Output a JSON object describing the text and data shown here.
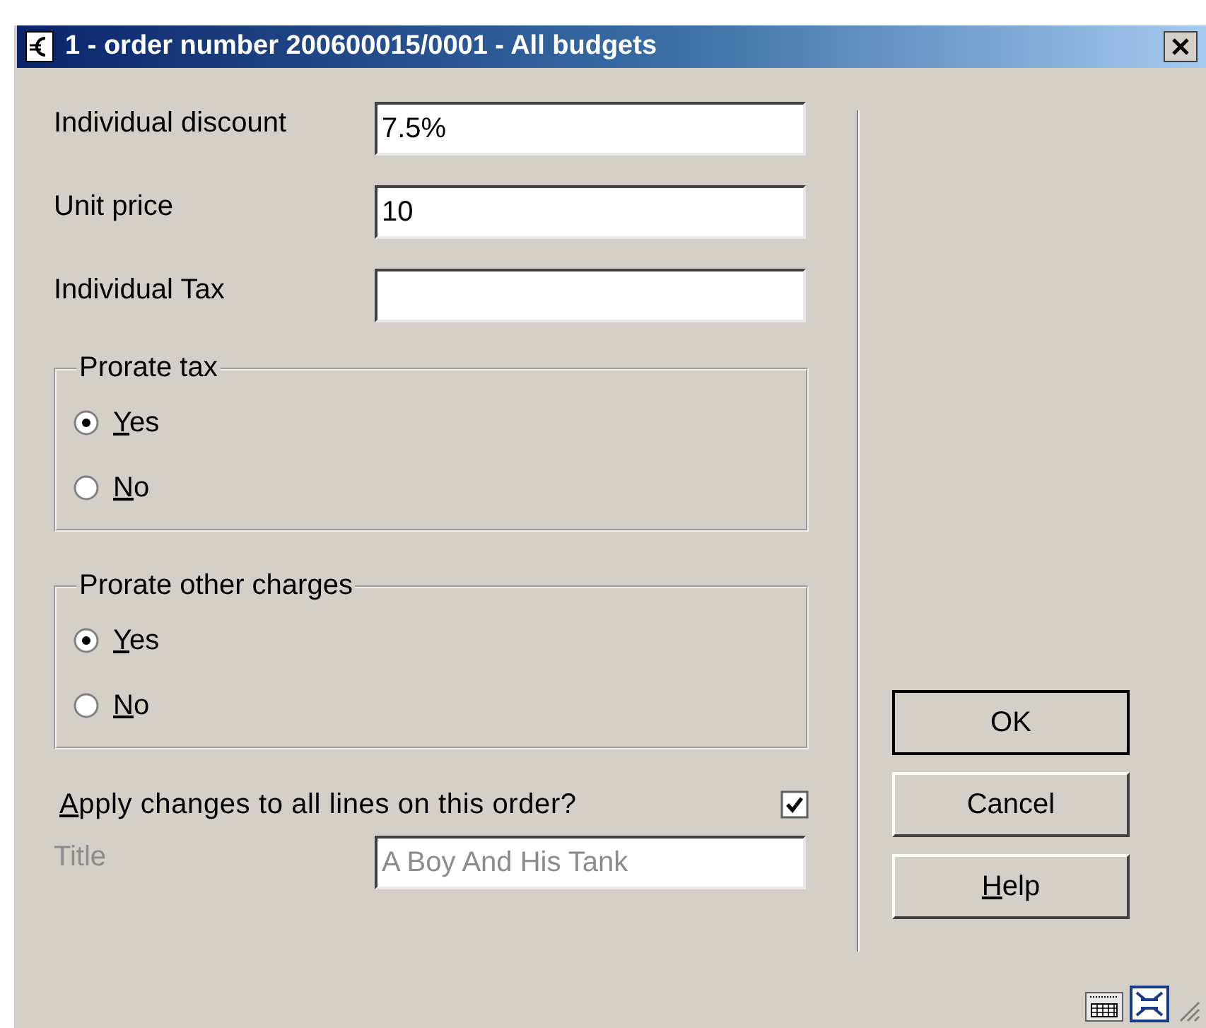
{
  "window": {
    "title": "1 - order number 200600015/0001 - All budgets"
  },
  "fields": [
    {
      "label": "Individual discount",
      "value": "7.5%",
      "disabled": false
    },
    {
      "label": "Unit price",
      "value": "10",
      "disabled": false
    },
    {
      "label": "Individual Tax",
      "disabled": false
    }
  ],
  "groups": [
    {
      "title": "Prorate tax",
      "options": [
        {
          "label": "Yes",
          "selected": true
        },
        {
          "label": "No",
          "selected": false
        }
      ]
    },
    {
      "title": "Prorate other charges",
      "options": [
        {
          "label": "Yes",
          "selected": true
        },
        {
          "label": "No",
          "selected": false
        }
      ]
    }
  ],
  "apply_all": {
    "label": "Apply changes to all lines on this order?",
    "checked": true
  },
  "title_field": {
    "label": "Title",
    "value": "A Boy And His Tank",
    "disabled": true
  },
  "buttons": [
    {
      "label": "OK",
      "default": true,
      "underline_first": false
    },
    {
      "label": "Cancel",
      "default": false,
      "underline_first": false
    },
    {
      "label": "Help",
      "default": false,
      "underline_first": true
    }
  ]
}
